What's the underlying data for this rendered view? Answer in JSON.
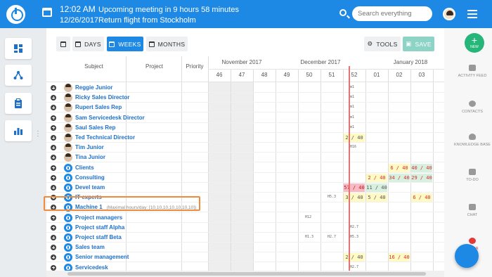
{
  "topbar": {
    "time": "12:02 AM",
    "meeting": "Upcoming meeting in 9 hours 58 minutes",
    "date": "12/26/2017",
    "event": "Return flight from Stockholm",
    "search_placeholder": "Search everything"
  },
  "toolbar": {
    "days": "DAYS",
    "weeks": "WEEKS",
    "months": "MONTHS",
    "tools": "TOOLS",
    "save": "SAVE"
  },
  "columns": {
    "subject": "Subject",
    "project": "Project",
    "priority": "Priority"
  },
  "months": [
    "November 2017",
    "December 2017",
    "January 2018"
  ],
  "weeks": [
    "46",
    "47",
    "48",
    "49",
    "50",
    "51",
    "52",
    "01",
    "02",
    "03"
  ],
  "rows": [
    {
      "name": "Reggie Junior",
      "type": "person",
      "cells": [
        {
          "w": 6,
          "t": "m1",
          "k": "small"
        }
      ]
    },
    {
      "name": "Ricky Sales Director",
      "type": "person",
      "cells": [
        {
          "w": 6,
          "t": "m1",
          "k": "small"
        }
      ]
    },
    {
      "name": "Rupert Sales Rep",
      "type": "person",
      "cells": [
        {
          "w": 6,
          "t": "m1",
          "k": "small"
        }
      ]
    },
    {
      "name": "Sam Servicedesk Director",
      "type": "person",
      "cells": [
        {
          "w": 6,
          "t": "m1",
          "k": "small"
        }
      ]
    },
    {
      "name": "Saul Sales Rep",
      "type": "person",
      "cells": [
        {
          "w": 6,
          "t": "m1",
          "k": "small"
        }
      ]
    },
    {
      "name": "Ted Technical Director",
      "type": "person",
      "cells": [
        {
          "w": 6,
          "t": "2 / 40",
          "k": "yellow"
        }
      ]
    },
    {
      "name": "Tim Junior",
      "type": "person",
      "cells": [
        {
          "w": 6,
          "t": "H16",
          "k": "small"
        }
      ]
    },
    {
      "name": "Tina Junior",
      "type": "person",
      "cells": []
    },
    {
      "name": "Clients",
      "type": "resource",
      "cells": [
        {
          "w": 8,
          "t": "6 / 40",
          "k": "yellow-red"
        },
        {
          "w": 9,
          "t": "40 / 40",
          "k": "green-red"
        }
      ]
    },
    {
      "name": "Consulting",
      "type": "resource",
      "cells": [
        {
          "w": 7,
          "t": "2 / 40",
          "k": "yellow-red"
        },
        {
          "w": 8,
          "t": "34 / 40",
          "k": "green-red"
        },
        {
          "w": 9,
          "t": "29 / 40",
          "k": "green-red"
        }
      ]
    },
    {
      "name": "Devel team",
      "type": "resource",
      "cells": [
        {
          "w": 6,
          "t": "57 / 40",
          "k": "pink"
        },
        {
          "w": 7,
          "t": "11 / 40",
          "k": "green"
        }
      ]
    },
    {
      "name": "IT experts",
      "type": "resource",
      "cells": [
        {
          "w": 5,
          "t": "H5.3",
          "k": "small"
        },
        {
          "w": 6,
          "t": "3 / 40",
          "k": "yellow"
        },
        {
          "w": 7,
          "t": "5 / 40",
          "k": "yellow"
        },
        {
          "w": 9,
          "t": "6 / 40",
          "k": "yellow-red"
        }
      ]
    },
    {
      "name": "Machine 1",
      "type": "resource",
      "note": "(Maximal hours/day: [10,10,10,10,10,10,10])",
      "cells": []
    },
    {
      "name": "Project managers",
      "type": "resource",
      "cells": [
        {
          "w": 4,
          "t": "H12",
          "k": "small"
        }
      ]
    },
    {
      "name": "Project staff Alpha",
      "type": "resource",
      "cells": [
        {
          "w": 6,
          "t": "H2.7",
          "k": "small"
        }
      ]
    },
    {
      "name": "Project staff Beta",
      "type": "resource",
      "cells": [
        {
          "w": 4,
          "t": "H1.3",
          "k": "small"
        },
        {
          "w": 5,
          "t": "H2.7",
          "k": "small"
        },
        {
          "w": 6,
          "t": "H5.3",
          "k": "small"
        }
      ]
    },
    {
      "name": "Sales team",
      "type": "resource",
      "cells": []
    },
    {
      "name": "Senior management",
      "type": "resource",
      "cells": [
        {
          "w": 6,
          "t": "2 / 40",
          "k": "yellow"
        },
        {
          "w": 8,
          "t": "16 / 40",
          "k": "yellow-red"
        }
      ]
    },
    {
      "name": "Servicedesk",
      "type": "resource",
      "cells": [
        {
          "w": 6,
          "t": "H2.7",
          "k": "small"
        }
      ]
    }
  ],
  "rightbar": {
    "new": "NEW",
    "activity": "ACTIVITY FEED",
    "contacts": "CONTACTS",
    "knowledge": "KNOWLEDGE BASE",
    "todo": "TO-DO",
    "chat": "CHAT",
    "timer": "TIMER"
  },
  "colors": {
    "accent": "#1e88e5",
    "new": "#26b67a",
    "save": "#8dd3c6",
    "today_line": "#e53935"
  }
}
